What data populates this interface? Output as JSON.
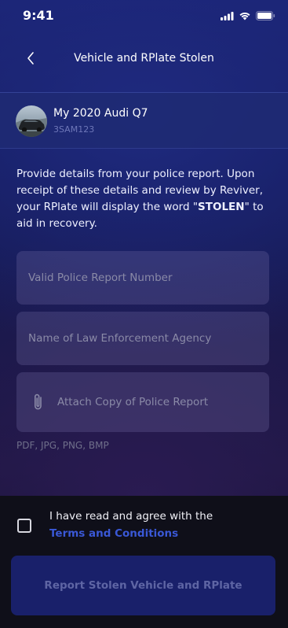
{
  "status": {
    "time": "9:41"
  },
  "nav": {
    "title": "Vehicle and RPlate Stolen"
  },
  "vehicle": {
    "name": "My 2020 Audi Q7",
    "plate": "3SAM123"
  },
  "intro": {
    "before": "Provide details from your police report. Upon receipt of these details and review by Reviver, your RPlate will display the word \"",
    "highlight": "STOLEN",
    "after": "\" to aid in recovery."
  },
  "form": {
    "report_number_placeholder": "Valid Police Report Number",
    "agency_placeholder": "Name of Law Enforcement Agency",
    "attach_label": "Attach Copy of Police Report",
    "formats": "PDF, JPG, PNG, BMP"
  },
  "agreement": {
    "text": "I have read and agree with the",
    "link": "Terms and Conditions"
  },
  "submit": {
    "label": "Report Stolen Vehicle and RPlate"
  },
  "colors": {
    "accent_link": "#3a58d6",
    "button_bg": "#19206a",
    "card_bg": "#1e2a73"
  }
}
